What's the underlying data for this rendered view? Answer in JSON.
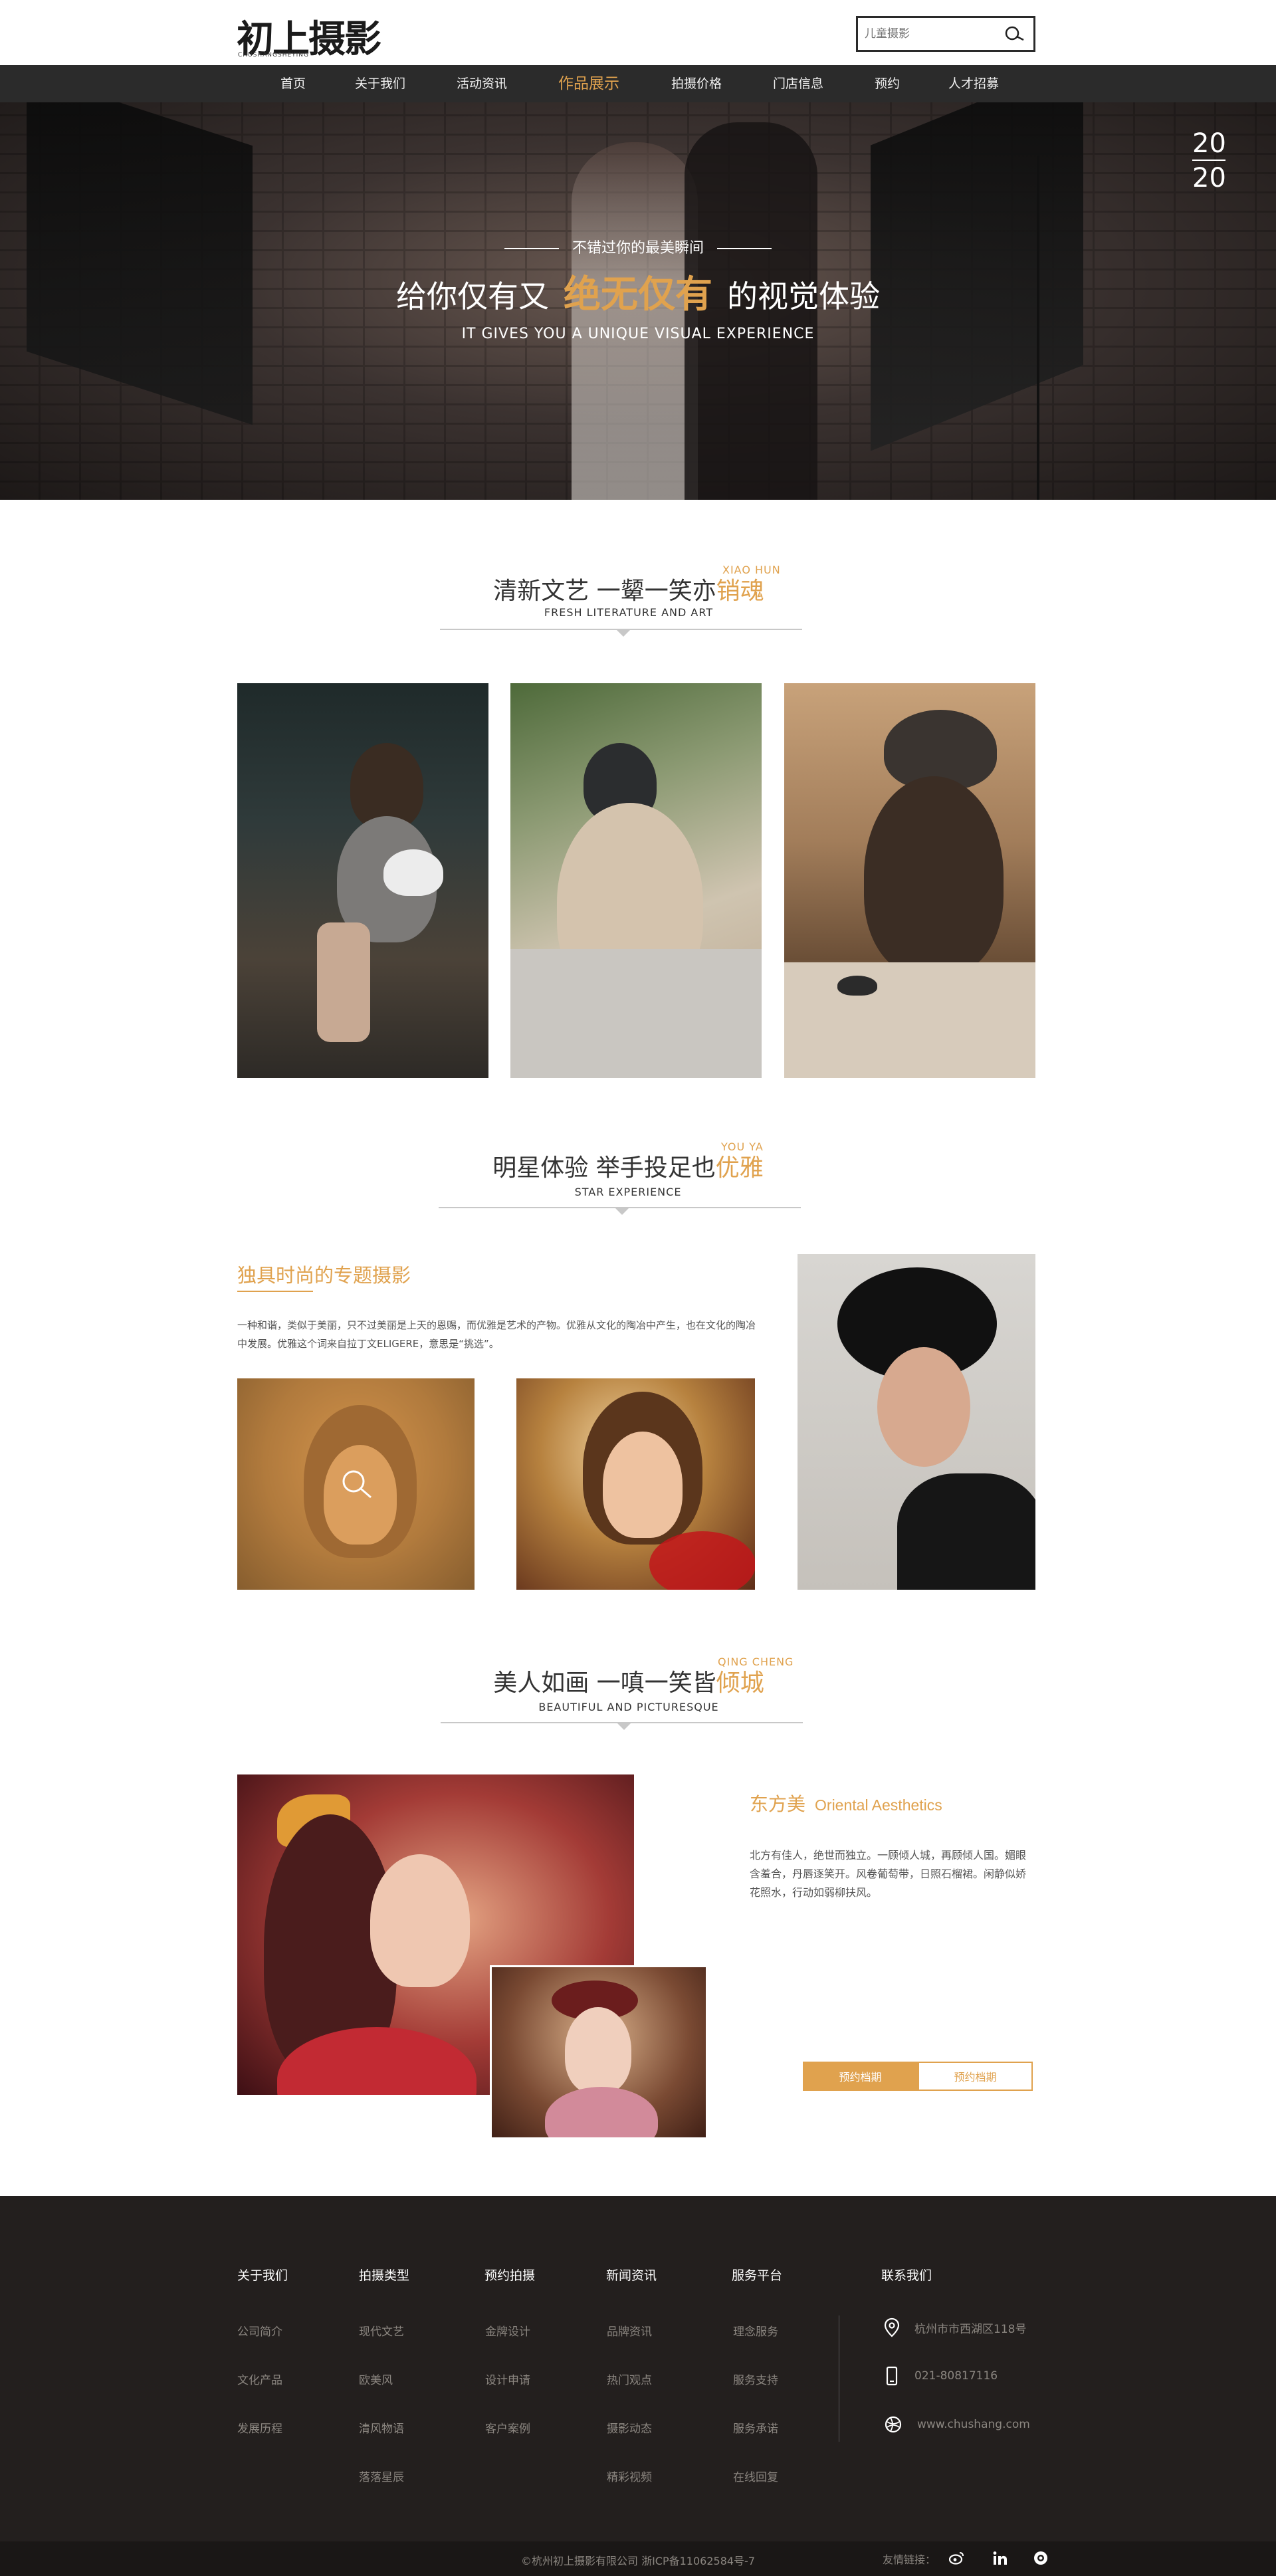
{
  "header": {
    "logo_text": "初上摄影",
    "logo_sub": "CHUSHANGSHEYING",
    "search_placeholder": "儿童摄影"
  },
  "nav": {
    "items": [
      {
        "label": "首页"
      },
      {
        "label": "关于我们"
      },
      {
        "label": "活动资讯"
      },
      {
        "label": "作品展示",
        "active": true
      },
      {
        "label": "拍摄价格"
      },
      {
        "label": "门店信息"
      },
      {
        "label": "预约"
      },
      {
        "label": "人才招募"
      }
    ]
  },
  "hero": {
    "year_top": "20",
    "year_bottom": "20",
    "subtitle": "不错过你的最美瞬间",
    "title_pre": "给你仅有又",
    "title_highlight": "绝无仅有",
    "title_post": "的视觉体验",
    "english": "IT GIVES YOU A UNIQUE VISUAL EXPERIENCE"
  },
  "section1": {
    "tag": "XIAO HUN",
    "title": "清新文艺 一颦一笑亦",
    "title_highlight": "销魂",
    "english": "FRESH LITERATURE AND ART"
  },
  "section2": {
    "tag": "YOU YA",
    "title": "明星体验 举手投足也",
    "title_highlight": "优雅",
    "english": "STAR EXPERIENCE",
    "heading": "独具时尚的专题摄影",
    "description": "一种和谐，类似于美丽，只不过美丽是上天的恩赐，而优雅是艺术的产物。优雅从文化的陶冶中产生，也在文化的陶冶中发展。优雅这个词来自拉丁文ELIGERE，意思是“挑选”。"
  },
  "section3": {
    "tag": "QING CHENG",
    "title": "美人如画 一嗔一笑皆",
    "title_highlight": "倾城",
    "english": "BEAUTIFUL AND PICTURESQUE",
    "heading_cn": "东方美",
    "heading_en": "Oriental Aesthetics",
    "description": "北方有佳人，绝世而独立。一顾倾人城，再顾倾人国。媚眼含羞合，丹唇逐笑开。风卷葡萄带，日照石榴裙。闲静似娇花照水，行动如弱柳扶风。",
    "btn_primary": "预约档期",
    "btn_secondary": "预约档期"
  },
  "footer": {
    "columns": [
      {
        "title": "关于我们",
        "links": [
          "公司简介",
          "文化产品",
          "发展历程"
        ]
      },
      {
        "title": "拍摄类型",
        "links": [
          "现代文艺",
          "欧美风",
          "清风物语",
          "落落星辰"
        ]
      },
      {
        "title": "预约拍摄",
        "links": [
          "金牌设计",
          "设计申请",
          "客户案例"
        ]
      },
      {
        "title": "新闻资讯",
        "links": [
          "品牌资讯",
          "热门观点",
          "摄影动态",
          "精彩视频"
        ]
      },
      {
        "title": "服务平台",
        "links": [
          "理念服务",
          "服务支持",
          "服务承诺",
          "在线回复"
        ]
      }
    ],
    "contact_title": "联系我们",
    "address": "杭州市市西湖区118号",
    "phone": "021-80817116",
    "website": "www.chushang.com",
    "copyright": "©杭州初上摄影有限公司 浙ICP备11062584号-7",
    "friends_label": "友情链接："
  },
  "colors": {
    "accent": "#e0a24e",
    "nav_bg": "#2b2b2b",
    "footer_bg": "#231f1e"
  }
}
